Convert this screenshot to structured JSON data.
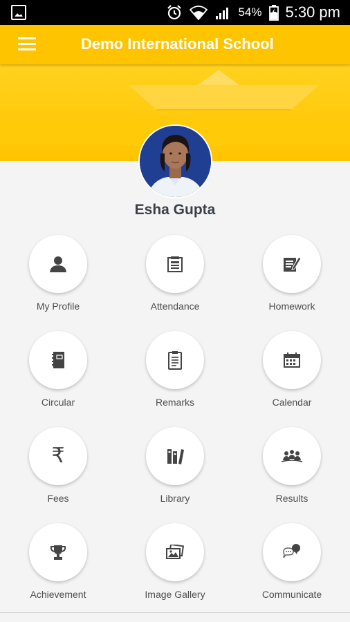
{
  "status_bar": {
    "battery_percent": "54%",
    "time": "5:30 pm",
    "icons": [
      "gallery-icon",
      "alarm-icon",
      "wifi-icon",
      "signal-icon",
      "battery-icon"
    ]
  },
  "app_bar": {
    "title": "Demo International School",
    "menu_icon": "hamburger-icon"
  },
  "colors": {
    "primary": "#ffc400",
    "status_bar": "#000000",
    "text": "#3b4046",
    "icon": "#444444"
  },
  "profile": {
    "name": "Esha Gupta"
  },
  "menu": {
    "items": [
      {
        "label": "My Profile",
        "icon": "person-icon"
      },
      {
        "label": "Attendance",
        "icon": "attendance-icon"
      },
      {
        "label": "Homework",
        "icon": "homework-icon"
      },
      {
        "label": "Circular",
        "icon": "notebook-icon"
      },
      {
        "label": "Remarks",
        "icon": "clipboard-icon"
      },
      {
        "label": "Calendar",
        "icon": "calendar-icon"
      },
      {
        "label": "Fees",
        "icon": "rupee-icon"
      },
      {
        "label": "Library",
        "icon": "books-icon"
      },
      {
        "label": "Results",
        "icon": "results-icon"
      },
      {
        "label": "Achievement",
        "icon": "trophy-icon"
      },
      {
        "label": "Image Gallery",
        "icon": "image-gallery-icon"
      },
      {
        "label": "Communicate",
        "icon": "chat-icon"
      }
    ]
  }
}
